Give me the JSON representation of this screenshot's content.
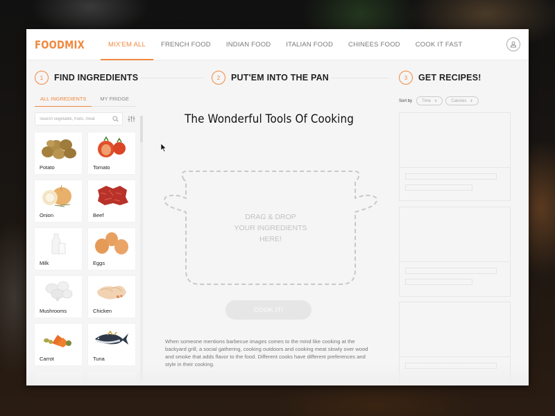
{
  "app": {
    "logo": "FOODMIX",
    "accent_color": "#f0883e"
  },
  "nav": {
    "items": [
      {
        "label": "MIX'EM ALL",
        "active": true
      },
      {
        "label": "FRENCH FOOD",
        "active": false
      },
      {
        "label": "INDIAN FOOD",
        "active": false
      },
      {
        "label": "ITALIAN FOOD",
        "active": false
      },
      {
        "label": "CHINEES FOOD",
        "active": false
      },
      {
        "label": "COOK IT FAST",
        "active": false
      }
    ],
    "profile_icon": "user-icon"
  },
  "steps": [
    {
      "number": "1",
      "title": "FIND INGREDIENTS"
    },
    {
      "number": "2",
      "title": "PUT'EM INTO THE PAN"
    },
    {
      "number": "3",
      "title": "GET RECIPES!"
    }
  ],
  "ingredients_panel": {
    "tabs": [
      {
        "label": "ALL INGREDIENTS",
        "active": true
      },
      {
        "label": "MY FRIDGE",
        "active": false
      }
    ],
    "search": {
      "placeholder": "Search vegetable, fruits, meat",
      "value": ""
    },
    "items": [
      {
        "label": "Potato",
        "icon": "potato-icon"
      },
      {
        "label": "Tomato",
        "icon": "tomato-icon"
      },
      {
        "label": "Onion",
        "icon": "onion-icon"
      },
      {
        "label": "Beef",
        "icon": "beef-icon"
      },
      {
        "label": "Milk",
        "icon": "milk-icon"
      },
      {
        "label": "Eggs",
        "icon": "eggs-icon"
      },
      {
        "label": "Mushrooms",
        "icon": "mushroom-icon"
      },
      {
        "label": "Chicken",
        "icon": "chicken-icon"
      },
      {
        "label": "Carrot",
        "icon": "carrot-icon"
      },
      {
        "label": "Tuna",
        "icon": "tuna-icon"
      }
    ]
  },
  "pan": {
    "title": "The Wonderful Tools Of Cooking",
    "drop_text_lines": [
      "DRAG & DROP",
      "YOUR INGREDIENTS",
      "HERE!"
    ],
    "cook_button": "COOK IT!",
    "description": "When someone mentions barbecue images comes to the mind like cooking at the backyard grill, a social gathering, cooking outdoors and cooking meat slowly over wood and smoke that adds flavor to the food. Different cooks have different preferences and style in their cooking."
  },
  "recipes": {
    "sort_label": "Sort by",
    "sort_options": [
      {
        "label": "Time"
      },
      {
        "label": "Calories"
      }
    ],
    "placeholder_cards": 3
  }
}
